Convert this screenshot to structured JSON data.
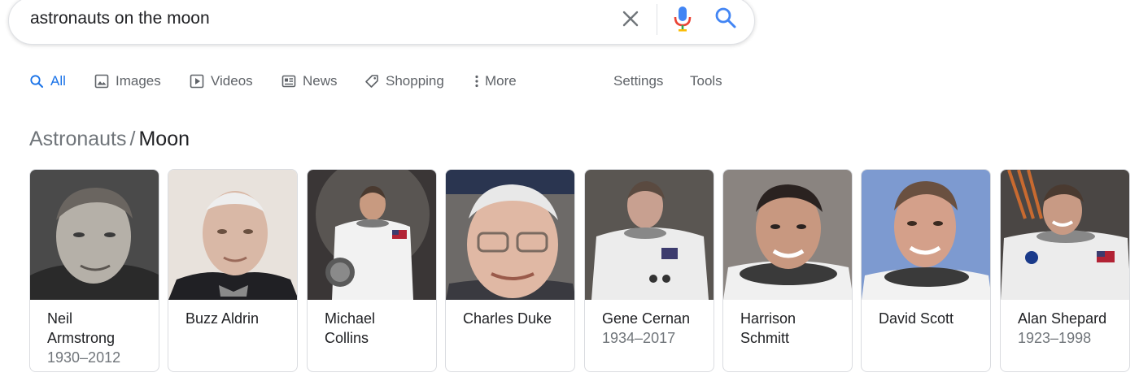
{
  "search": {
    "query": "astronauts on the moon"
  },
  "icons": {
    "clear": "close-icon",
    "mic": "microphone-icon",
    "search": "search-icon"
  },
  "colors": {
    "accent": "#1a73e8",
    "mic_blue": "#4285f4",
    "mic_red": "#ea4335"
  },
  "tabs": [
    {
      "label": "All",
      "icon": "search-icon",
      "active": true
    },
    {
      "label": "Images",
      "icon": "image-icon"
    },
    {
      "label": "Videos",
      "icon": "play-icon"
    },
    {
      "label": "News",
      "icon": "newspaper-icon"
    },
    {
      "label": "Shopping",
      "icon": "tag-icon"
    },
    {
      "label": "More",
      "icon": "more-vertical-icon"
    }
  ],
  "tools": {
    "settings_label": "Settings",
    "tools_label": "Tools"
  },
  "breadcrumb": {
    "parent": "Astronauts",
    "separator": "/",
    "current": "Moon"
  },
  "astronauts": [
    {
      "name_line1": "Neil",
      "name_line2": "Armstrong",
      "years": "1930–2012"
    },
    {
      "name_line1": "Buzz Aldrin",
      "name_line2": "",
      "years": ""
    },
    {
      "name_line1": "Michael",
      "name_line2": "Collins",
      "years": ""
    },
    {
      "name_line1": "Charles Duke",
      "name_line2": "",
      "years": ""
    },
    {
      "name_line1": "Gene Cernan",
      "name_line2": "",
      "years": "1934–2017"
    },
    {
      "name_line1": "Harrison",
      "name_line2": "Schmitt",
      "years": ""
    },
    {
      "name_line1": "David Scott",
      "name_line2": "",
      "years": ""
    },
    {
      "name_line1": "Alan Shepard",
      "name_line2": "",
      "years": "1923–1998"
    }
  ]
}
